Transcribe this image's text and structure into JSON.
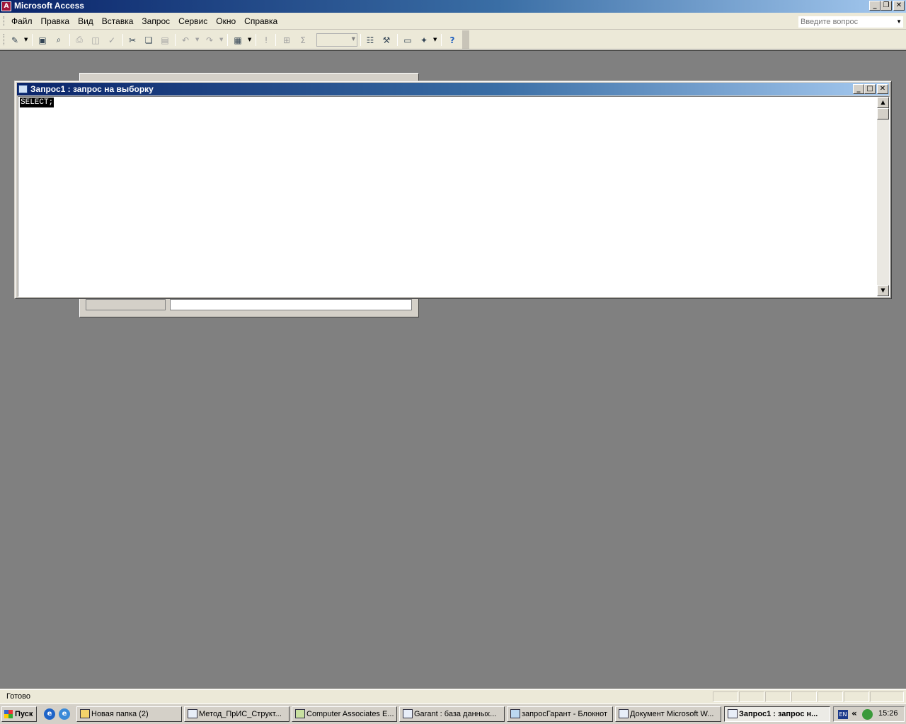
{
  "app": {
    "title": "Microsoft Access"
  },
  "menu": {
    "items": [
      "Файл",
      "Правка",
      "Вид",
      "Вставка",
      "Запрос",
      "Сервис",
      "Окно",
      "Справка"
    ],
    "ask_placeholder": "Введите вопрос"
  },
  "toolbar": {
    "buttons": [
      "view-icon",
      "save-icon",
      "search-icon",
      "print-icon",
      "print-preview-icon",
      "spelling-icon",
      "cut-icon",
      "copy-icon",
      "paste-icon",
      "undo-icon",
      "redo-icon",
      "query-type-icon",
      "run-icon",
      "show-table-icon",
      "totals-icon",
      "properties-icon",
      "builder-icon",
      "database-window-icon",
      "new-object-icon",
      "help-icon"
    ],
    "top_values": ""
  },
  "query_window": {
    "title": "Запрос1 : запрос на выборку",
    "sql": "SELECT;"
  },
  "status": {
    "text": "Готово"
  },
  "taskbar": {
    "start_label": "Пуск",
    "tasks": [
      "Новая папка (2)",
      "Метод_ПрИС_Структ...",
      "Computer Associates E...",
      "Garant : база данных...",
      "запросГарант - Блокнот",
      "Документ Microsoft W...",
      "Запрос1 : запрос н..."
    ],
    "active_task": 6,
    "lang": "EN",
    "clock": "15:26"
  }
}
